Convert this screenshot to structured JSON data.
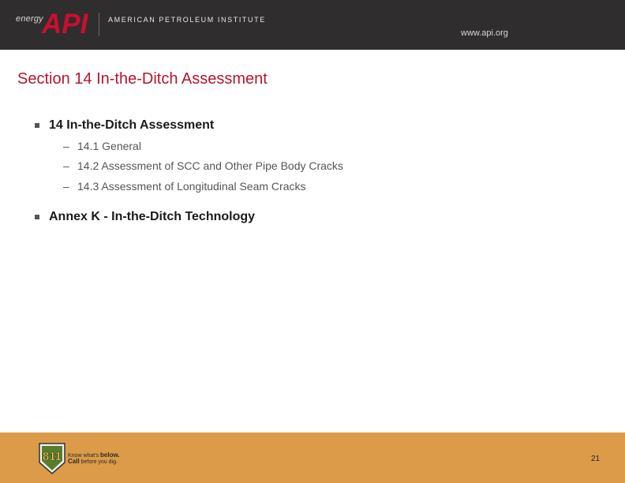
{
  "header": {
    "logo_prefix": "energy",
    "logo_mark": "API",
    "org_name": "AMERICAN PETROLEUM INSTITUTE",
    "website": "www.api.org"
  },
  "slide": {
    "title": "Section 14 In-the-Ditch Assessment",
    "bullets": [
      {
        "label": "14 In-the-Ditch Assessment",
        "sub": [
          "14.1 General",
          "14.2 Assessment of SCC and Other Pipe Body Cracks",
          "14.3 Assessment of Longitudinal Seam Cracks"
        ]
      },
      {
        "label": "Annex K - In-the-Ditch Technology",
        "sub": []
      }
    ]
  },
  "footer": {
    "badge_number": "811",
    "line1_prefix": "Know what's ",
    "line1_bold": "below.",
    "line2_bold": "Call",
    "line2_suffix": " before you dig.",
    "page_number": "21"
  },
  "colors": {
    "header_bg": "#2f2d2d",
    "title": "#b5162b",
    "api_red": "#c8102e",
    "footer_bg": "#dc9b48"
  }
}
